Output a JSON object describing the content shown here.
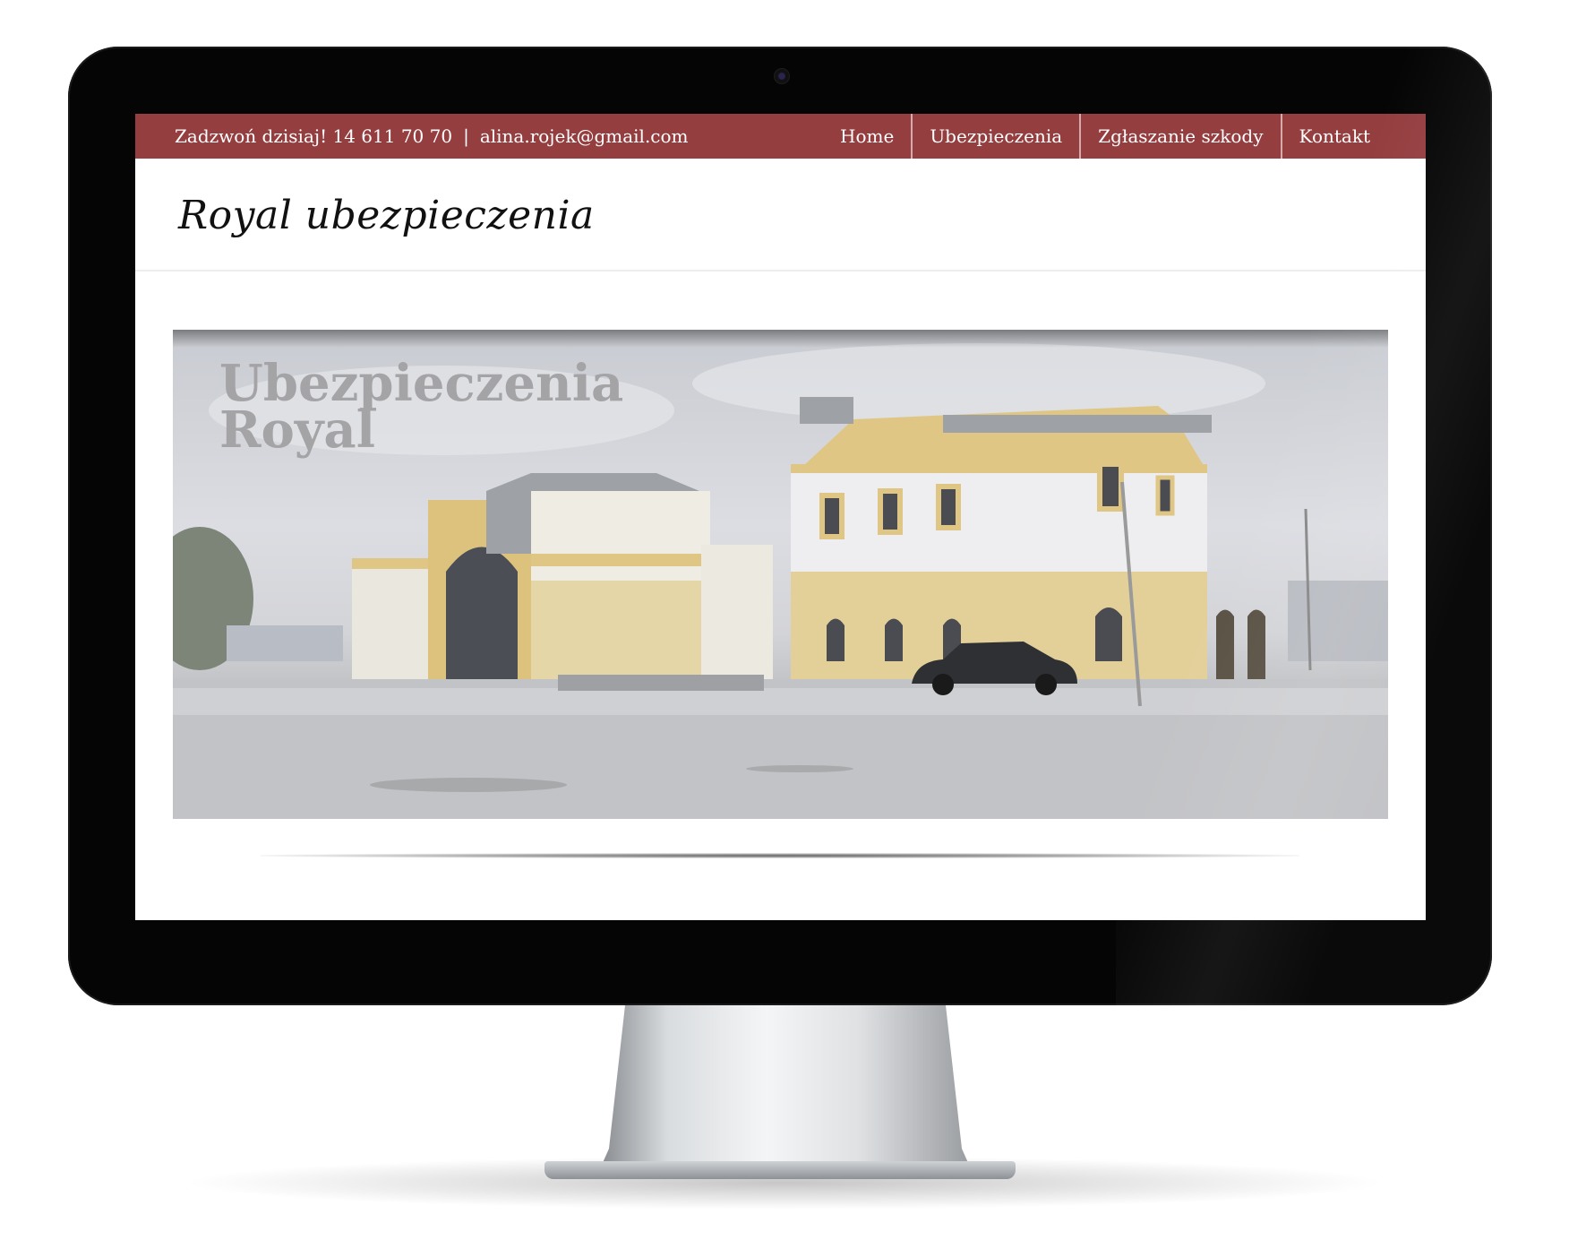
{
  "topbar": {
    "phone_text": "Zadzwoń dzisiaj! 14 611 70 70",
    "separator": "|",
    "email": "alina.rojek@gmail.com"
  },
  "nav": {
    "items": [
      {
        "label": "Home"
      },
      {
        "label": "Ubezpieczenia"
      },
      {
        "label": "Zgłaszanie szkody"
      },
      {
        "label": "Kontakt"
      }
    ]
  },
  "site": {
    "title": "Royal ubezpieczenia"
  },
  "banner": {
    "title_line1": "Ubezpieczenia",
    "title_line2": "Royal"
  },
  "colors": {
    "topbar": "#953e40",
    "monitor_bezel": "#050505",
    "building_wall": "#eeeef0",
    "building_trim": "#e1c889"
  }
}
